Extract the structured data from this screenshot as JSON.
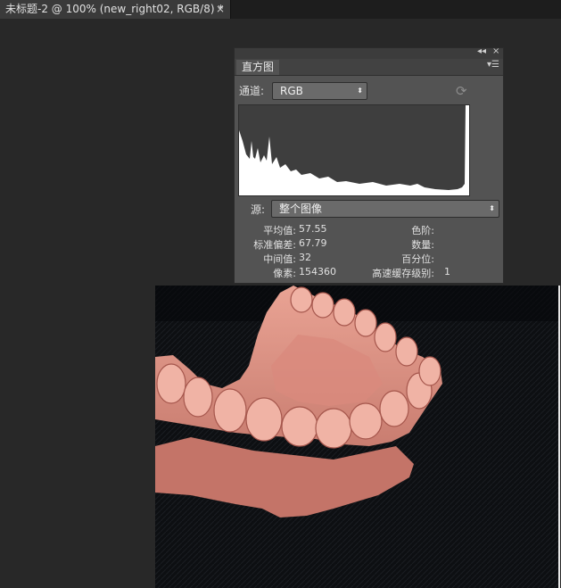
{
  "document_tab": {
    "title": "未标题-2 @ 100% (new_right02, RGB/8) *",
    "close": "×"
  },
  "panel": {
    "collapse_glyph": "◂◂",
    "close_glyph": "×",
    "tab_label": "直方图",
    "menu_glyph": "▾☰",
    "channel": {
      "label": "通道:",
      "value": "RGB",
      "arrow": "⬍"
    },
    "refresh_glyph": "⟳",
    "source": {
      "label": "源:",
      "value": "整个图像",
      "arrow": "⬍"
    },
    "stats_left": [
      {
        "label": "平均值:",
        "value": "57.55"
      },
      {
        "label": "标准偏差:",
        "value": "67.79"
      },
      {
        "label": "中间值:",
        "value": "32"
      },
      {
        "label": "像素:",
        "value": "154360"
      }
    ],
    "stats_right": [
      {
        "label": "色阶:",
        "value": ""
      },
      {
        "label": "数量:",
        "value": ""
      },
      {
        "label": "百分位:",
        "value": ""
      },
      {
        "label": "高速缓存级别:",
        "value": "1"
      }
    ]
  },
  "colors": {
    "workspace": "#282828",
    "panel": "#535353",
    "histogram_bg": "#ffffff",
    "histogram_fill": "#3e3e3e",
    "model_pink": "#e0958a"
  },
  "icons": {
    "refresh": "refresh-icon",
    "panel_menu": "panel-menu-icon",
    "collapse": "collapse-icon",
    "close": "close-icon"
  }
}
